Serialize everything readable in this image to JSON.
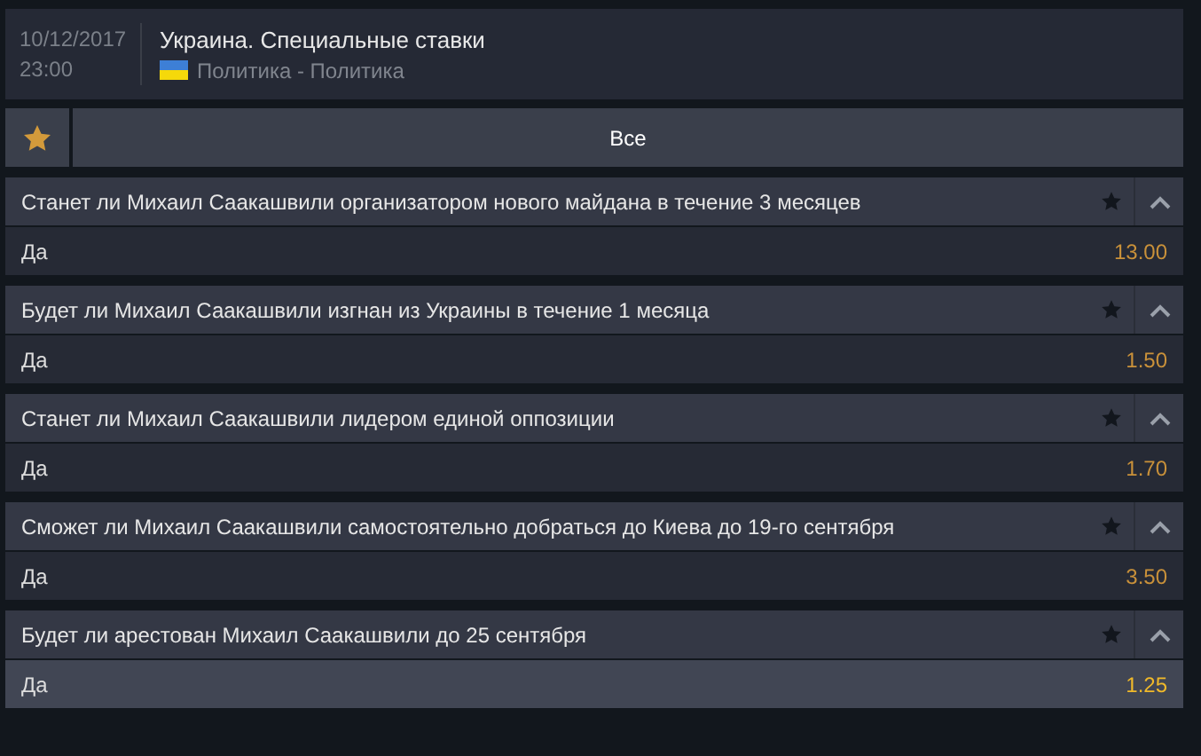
{
  "event": {
    "date": "10/12/2017",
    "time": "23:00",
    "title": "Украина. Специальные ставки",
    "category": "Политика - Политика"
  },
  "filter": {
    "favorite_on": true,
    "tabs": [
      {
        "label": "Все",
        "selected": true
      }
    ]
  },
  "markets": [
    {
      "title": "Станет ли Михаил Саакашвили организатором нового майдана в течение 3 месяцев",
      "expanded": true,
      "outcomes": [
        {
          "label": "Да",
          "odds": "13.00",
          "highlighted": false
        }
      ]
    },
    {
      "title": "Будет ли Михаил Саакашвили изгнан из Украины в течение 1 месяца",
      "expanded": true,
      "outcomes": [
        {
          "label": "Да",
          "odds": "1.50",
          "highlighted": false
        }
      ]
    },
    {
      "title": "Станет ли Михаил Саакашвили лидером единой оппозиции",
      "expanded": true,
      "outcomes": [
        {
          "label": "Да",
          "odds": "1.70",
          "highlighted": false
        }
      ]
    },
    {
      "title": "Сможет ли Михаил Саакашвили самостоятельно добраться до Киева до 19-го сентября",
      "expanded": true,
      "outcomes": [
        {
          "label": "Да",
          "odds": "3.50",
          "highlighted": false
        }
      ]
    },
    {
      "title": "Будет ли арестован Михаил Саакашвили до 25 сентября",
      "expanded": true,
      "outcomes": [
        {
          "label": "Да",
          "odds": "1.25",
          "highlighted": true
        }
      ]
    }
  ]
}
